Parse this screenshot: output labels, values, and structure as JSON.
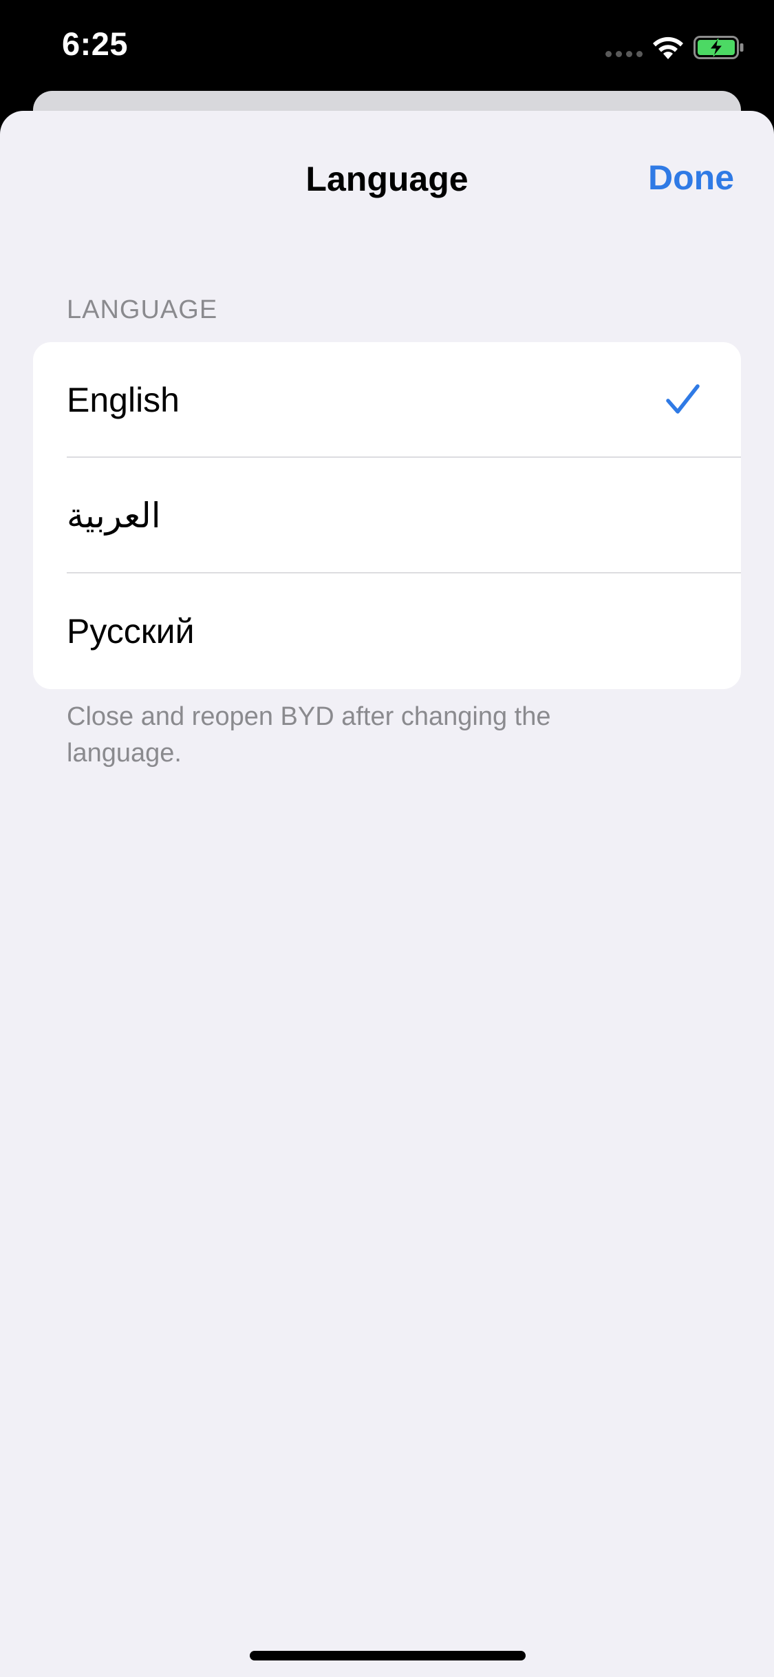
{
  "status_bar": {
    "time": "6:25",
    "icons": [
      "cellular-signal-icon",
      "wifi-icon",
      "battery-charging-icon"
    ],
    "battery_color": "#4cd964"
  },
  "sheet": {
    "title": "Language",
    "done_label": "Done",
    "accent_color": "#2f7ae5"
  },
  "language_section": {
    "header": "LANGUAGE",
    "items": [
      {
        "label": "English",
        "selected": true
      },
      {
        "label": "العربية",
        "selected": false
      },
      {
        "label": "Русский",
        "selected": false
      }
    ],
    "footer": "Close and reopen BYD after changing the language."
  }
}
